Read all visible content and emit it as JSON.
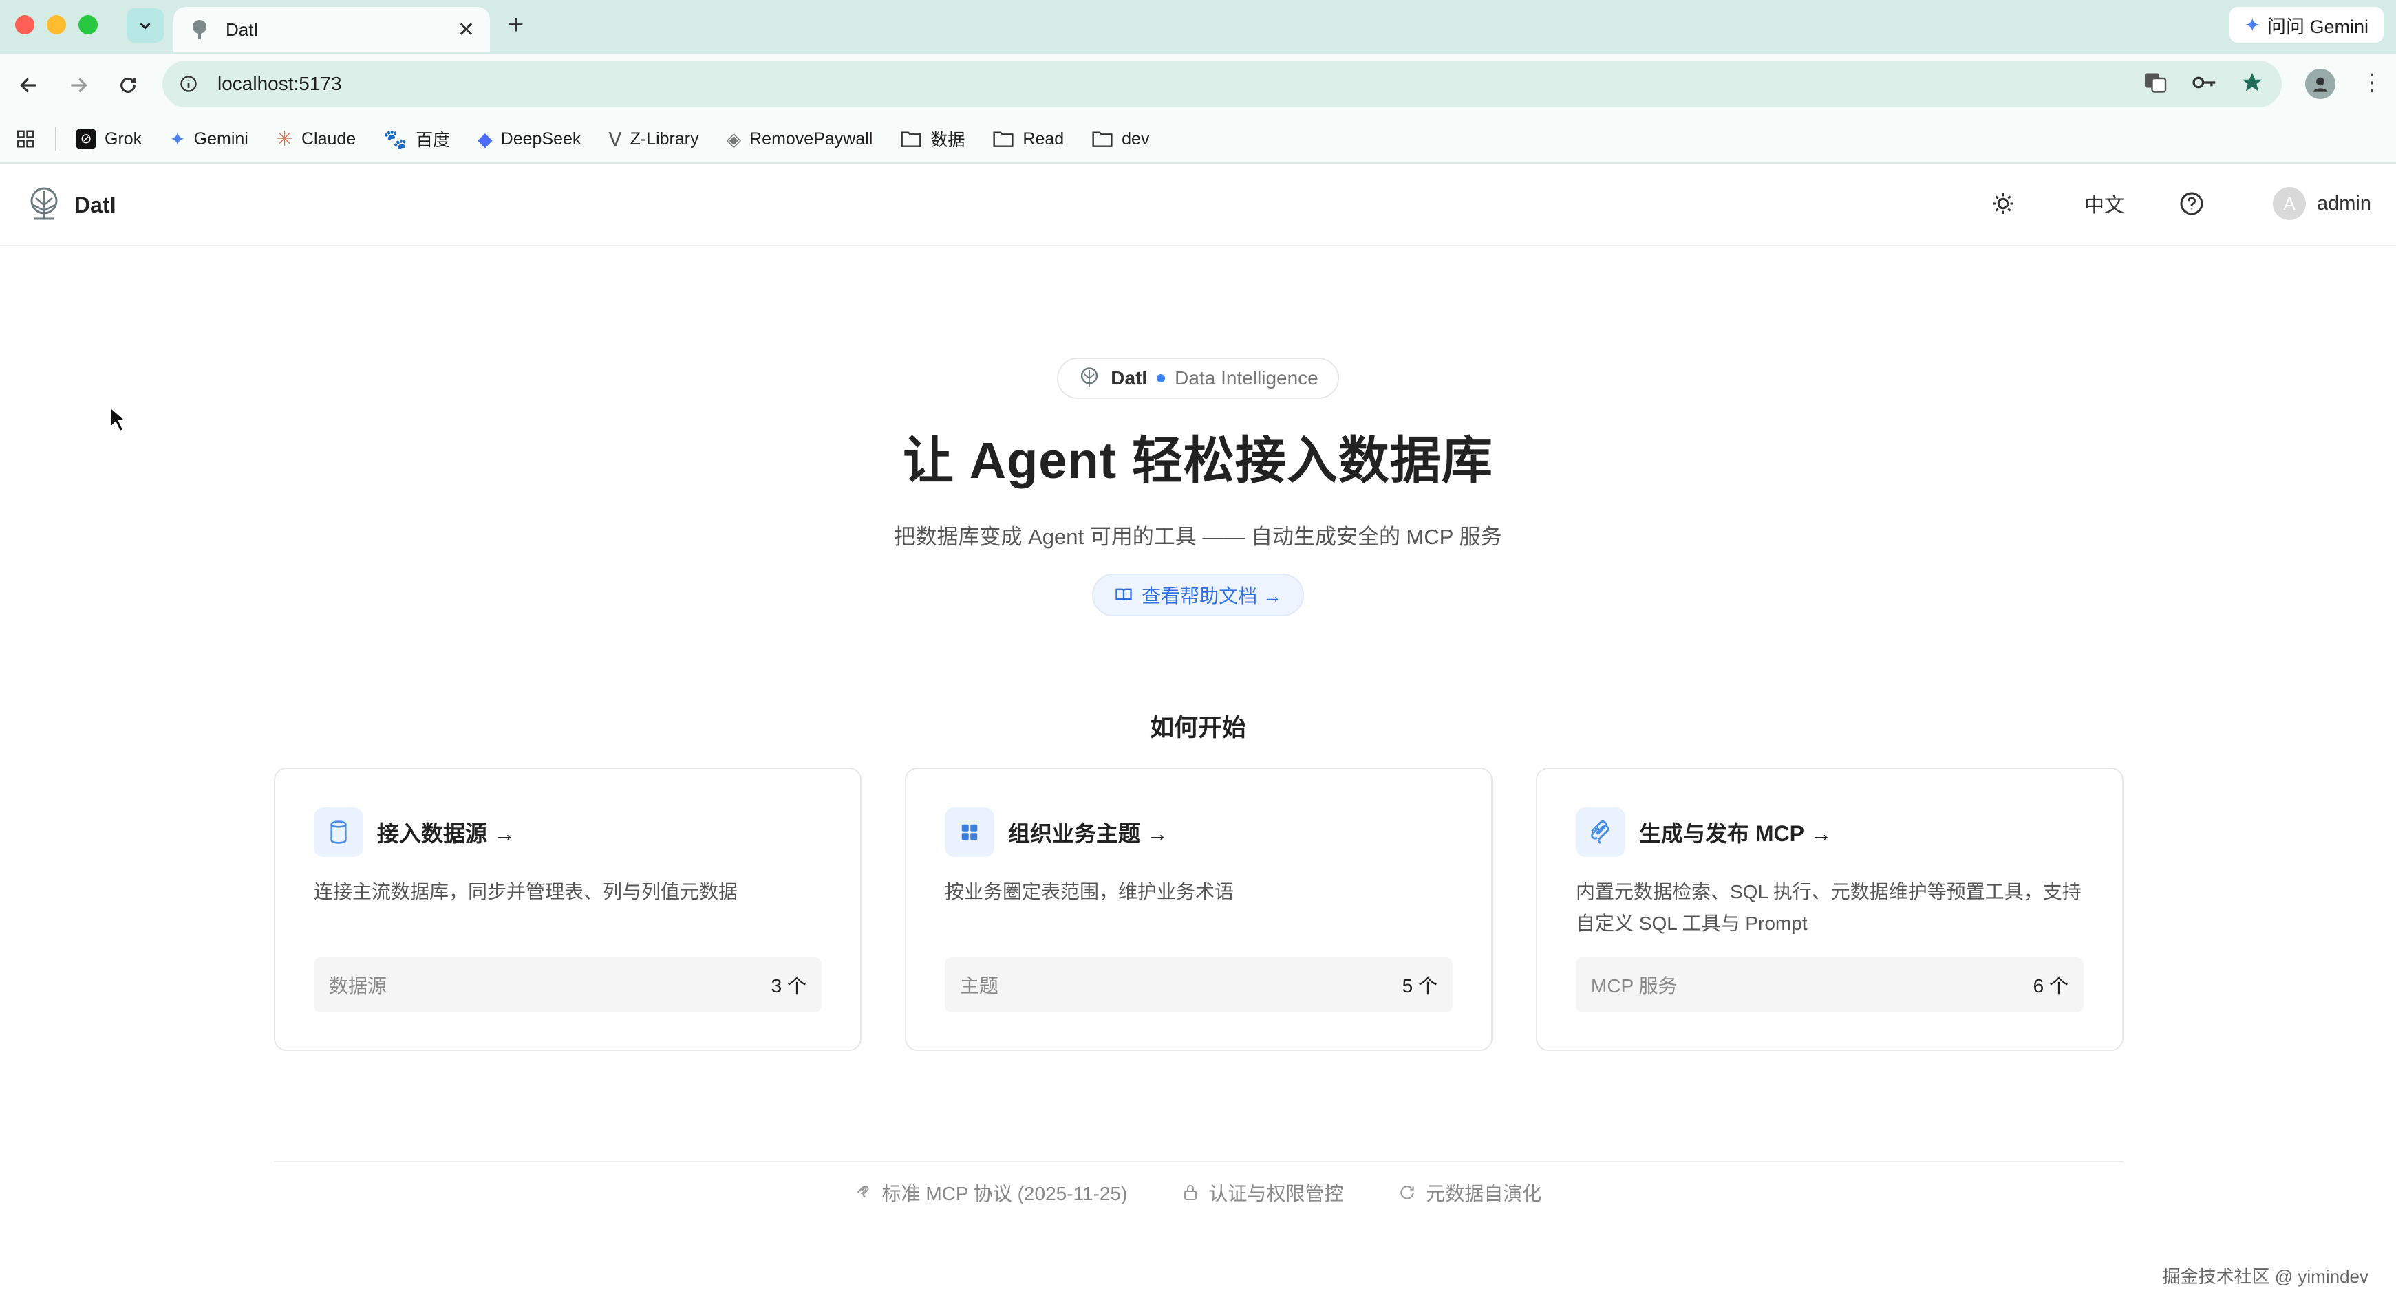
{
  "browser": {
    "tab_title": "DatI",
    "new_tab": "+",
    "gemini_label": "问问 Gemini",
    "url": "localhost:5173",
    "bookmarks": [
      {
        "label": "Grok",
        "icon": "grok-icon"
      },
      {
        "label": "Gemini",
        "icon": "gemini-icon"
      },
      {
        "label": "Claude",
        "icon": "claude-icon"
      },
      {
        "label": "百度",
        "icon": "baidu-icon"
      },
      {
        "label": "DeepSeek",
        "icon": "deepseek-icon"
      },
      {
        "label": "Z-Library",
        "icon": "zlibrary-icon"
      },
      {
        "label": "RemovePaywall",
        "icon": "removepaywall-icon"
      },
      {
        "label": "数据",
        "icon": "folder-icon"
      },
      {
        "label": "Read",
        "icon": "folder-icon"
      },
      {
        "label": "dev",
        "icon": "folder-icon"
      }
    ]
  },
  "header": {
    "brand": "DatI",
    "language": "中文",
    "avatar_initial": "A",
    "username": "admin"
  },
  "hero": {
    "pill_name": "DatI",
    "pill_sub": "Data Intelligence",
    "title": "让 Agent 轻松接入数据库",
    "subtitle": "把数据库变成 Agent 可用的工具 —— 自动生成安全的 MCP 服务",
    "help_label": "查看帮助文档 →"
  },
  "section_title": "如何开始",
  "cards": [
    {
      "title": "接入数据源 →",
      "desc": "连接主流数据库，同步并管理表、列与列值元数据",
      "stat_label": "数据源",
      "stat_value": "3 个",
      "icon": "database-icon"
    },
    {
      "title": "组织业务主题 →",
      "desc": "按业务圈定表范围，维护业务术语",
      "stat_label": "主题",
      "stat_value": "5 个",
      "icon": "grid-icon"
    },
    {
      "title": "生成与发布 MCP →",
      "desc": "内置元数据检索、SQL 执行、元数据维护等预置工具，支持自定义 SQL 工具与 Prompt",
      "stat_label": "MCP 服务",
      "stat_value": "6 个",
      "icon": "mcp-icon"
    }
  ],
  "footer": [
    {
      "label": "标准 MCP 协议 (2025-11-25)",
      "icon": "protocol-icon"
    },
    {
      "label": "认证与权限管控",
      "icon": "lock-icon"
    },
    {
      "label": "元数据自演化",
      "icon": "refresh-icon"
    }
  ],
  "watermark": "掘金技术社区 @ yimindev",
  "colors": {
    "accent": "#2f6fe4",
    "chrome": "#d5ebe5"
  }
}
